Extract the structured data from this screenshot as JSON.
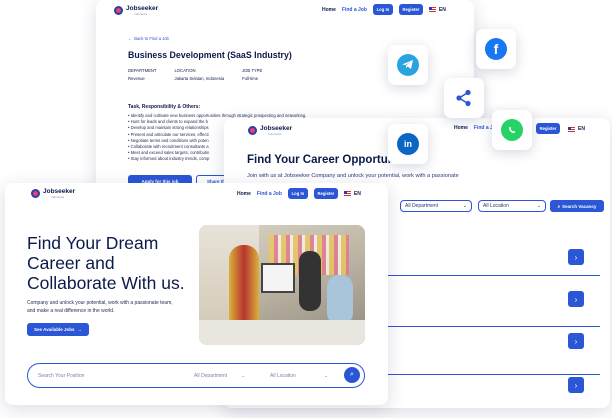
{
  "logo": {
    "name": "Jobseeker",
    "sub": "Indonesia"
  },
  "nav": {
    "home": "Home",
    "find_job": "Find a Job",
    "login": "Log In",
    "register": "Register",
    "lang": "EN"
  },
  "detail": {
    "back": "Back to Find a Job",
    "title": "Business Development (SaaS Industry)",
    "department_label": "DEPARTMENT",
    "department_value": "Revenue",
    "location_label": "LOCATION",
    "location_value": "Jakarta Selatan, Indonesia",
    "jobtype_label": "JOB TYPE",
    "jobtype_value": "Full-time",
    "section_title": "Task, Responsibility & Others:",
    "bullets": [
      "Identify and cultivate new business opportunities through strategic prospecting and networking.",
      "Hunt for leads and clients to expand the b",
      "Develop and maintain strong relationships",
      "Present and articulate our services, effecti",
      "Negotiate terms and conditions with poten",
      "Collaborate with recruitment consultants a",
      "Meet and exceed sales targets, contributin",
      "Stay informed about industry trends, comp"
    ],
    "apply": "Apply for this job",
    "share": "Share th"
  },
  "careers": {
    "title": "Find Your Career Opportunities",
    "desc": "Join with us at Jobseeker Company and unlock your potential, work with a passionate",
    "dept": "All Department",
    "loc": "All Location",
    "search": "Search Vacancy"
  },
  "hero": {
    "title_l1": "Find Your Dream",
    "title_l2": "Career and",
    "title_l3": "Collaborate With us.",
    "desc_l1": "Company and unlock your potential, work with a passionate team,",
    "desc_l2": "and make a real difference in the world.",
    "cta": "See Available Jobs",
    "search_placeholder": "Search Your Position",
    "dept": "All Department",
    "loc": "All Location"
  },
  "social_icons": [
    "telegram-icon",
    "facebook-icon",
    "share-icon",
    "whatsapp-icon",
    "linkedin-icon"
  ],
  "colors": {
    "primary": "#2b56d6",
    "navy": "#0b1a4a",
    "telegram": "#2aa3df",
    "facebook": "#1877f2",
    "whatsapp": "#25d366",
    "linkedin": "#0a66c2"
  }
}
